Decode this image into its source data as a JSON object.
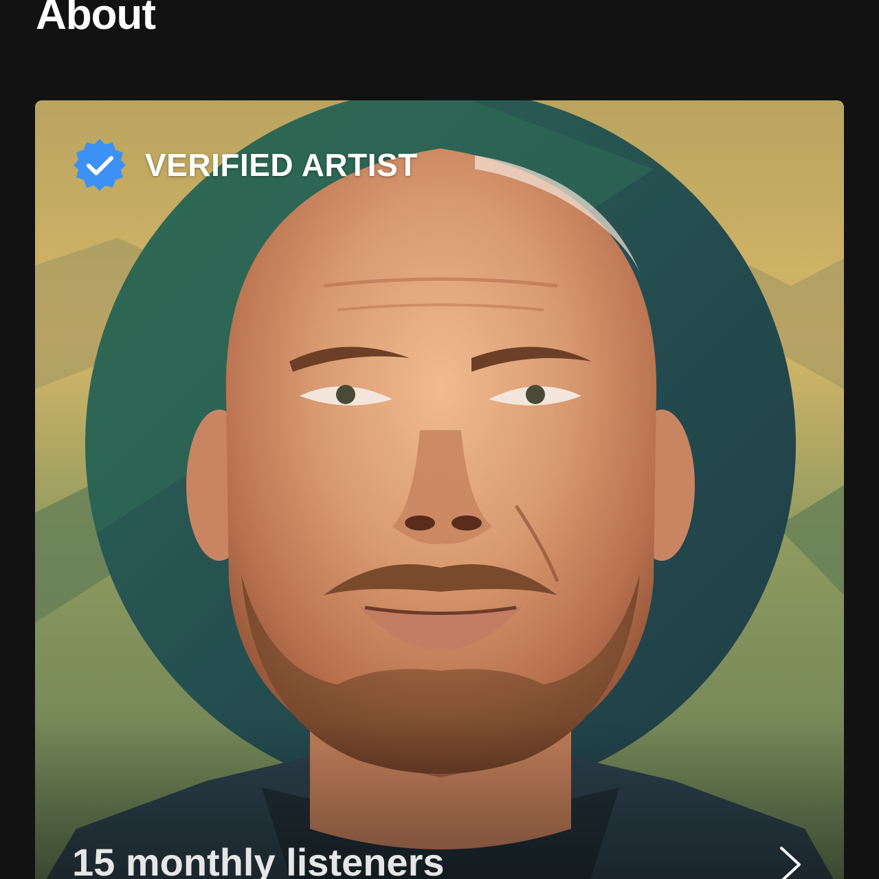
{
  "section": {
    "title": "About"
  },
  "artist_card": {
    "verified_label": "VERIFIED ARTIST",
    "monthly_listeners": "15 monthly listeners",
    "verified_icon": "verified-badge-icon",
    "chevron_icon": "chevron-right-icon",
    "image": "artist-portrait"
  },
  "colors": {
    "background": "#121212",
    "verified_badge": "#3d91f4",
    "text": "#ffffff",
    "listeners_text": "#e6e6e6"
  }
}
